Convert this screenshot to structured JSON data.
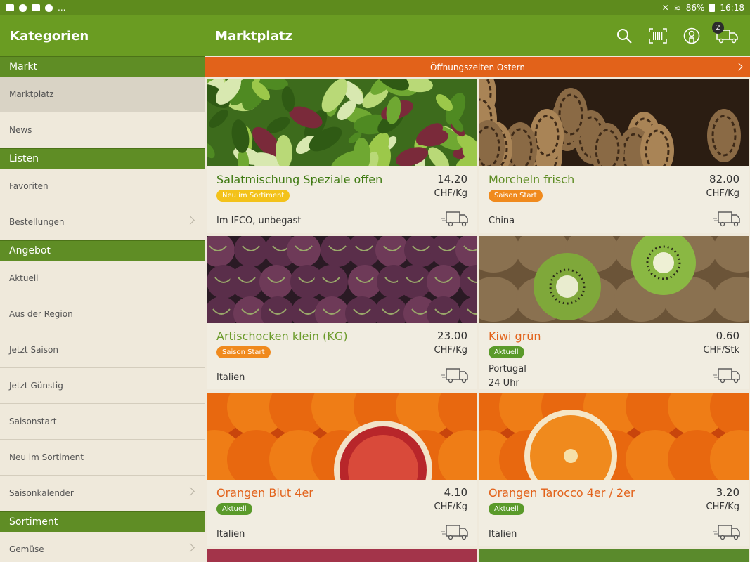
{
  "status_bar": {
    "battery": "86%",
    "time": "16:18",
    "more": "..."
  },
  "left_header": {
    "title": "Kategorien"
  },
  "main_header": {
    "title": "Marktplatz",
    "cart_count": "2"
  },
  "sidebar": {
    "sections": [
      {
        "title": "Markt",
        "items": [
          {
            "label": "Marktplatz",
            "active": true,
            "chevron": false
          },
          {
            "label": "News",
            "active": false,
            "chevron": false
          }
        ]
      },
      {
        "title": "Listen",
        "items": [
          {
            "label": "Favoriten",
            "active": false,
            "chevron": false
          },
          {
            "label": "Bestellungen",
            "active": false,
            "chevron": true
          }
        ]
      },
      {
        "title": "Angebot",
        "items": [
          {
            "label": "Aktuell",
            "active": false,
            "chevron": false
          },
          {
            "label": "Aus der Region",
            "active": false,
            "chevron": false
          },
          {
            "label": "Jetzt Saison",
            "active": false,
            "chevron": false
          },
          {
            "label": "Jetzt Günstig",
            "active": false,
            "chevron": false
          },
          {
            "label": "Saisonstart",
            "active": false,
            "chevron": false
          },
          {
            "label": "Neu im Sortiment",
            "active": false,
            "chevron": false
          },
          {
            "label": "Saisonkalender",
            "active": false,
            "chevron": true
          }
        ]
      },
      {
        "title": "Sortiment",
        "items": [
          {
            "label": "Gemüse",
            "active": false,
            "chevron": true
          }
        ]
      }
    ]
  },
  "banner": {
    "text": "Öffnungszeiten Ostern"
  },
  "products": [
    {
      "name": "Salatmischung Speziale offen",
      "name_color": "#3f7a12",
      "price": "14.20",
      "unit": "CHF/Kg",
      "badge": "Neu im Sortiment",
      "badge_color": "#f3c21a",
      "origin": [
        "Im IFCO, unbegast"
      ],
      "image": "salad"
    },
    {
      "name": "Morcheln frisch",
      "name_color": "#5f8d25",
      "price": "82.00",
      "unit": "CHF/Kg",
      "badge": "Saison Start",
      "badge_color": "#f08a1d",
      "origin": [
        "China"
      ],
      "image": "morel"
    },
    {
      "name": "Artischocken klein (KG)",
      "name_color": "#6b9b2b",
      "price": "23.00",
      "unit": "CHF/Kg",
      "badge": "Saison Start",
      "badge_color": "#f08a1d",
      "origin": [
        "Italien"
      ],
      "image": "artichoke"
    },
    {
      "name": "Kiwi grün",
      "name_color": "#e2621a",
      "price": "0.60",
      "unit": "CHF/Stk",
      "badge": "Aktuell",
      "badge_color": "#5a9a2a",
      "origin": [
        "Portugal",
        "24 Uhr"
      ],
      "image": "kiwi"
    },
    {
      "name": "Orangen Blut 4er",
      "name_color": "#e2621a",
      "price": "4.10",
      "unit": "CHF/Kg",
      "badge": "Aktuell",
      "badge_color": "#5a9a2a",
      "origin": [
        "Italien"
      ],
      "image": "orange"
    },
    {
      "name": "Orangen Tarocco 4er / 2er",
      "name_color": "#e2621a",
      "price": "3.20",
      "unit": "CHF/Kg",
      "badge": "Aktuell",
      "badge_color": "#5a9a2a",
      "origin": [
        "Italien"
      ],
      "image": "orange2"
    }
  ],
  "colors": {
    "header": "#6a9c22",
    "section": "#5f8d25",
    "banner": "#e2621a"
  }
}
